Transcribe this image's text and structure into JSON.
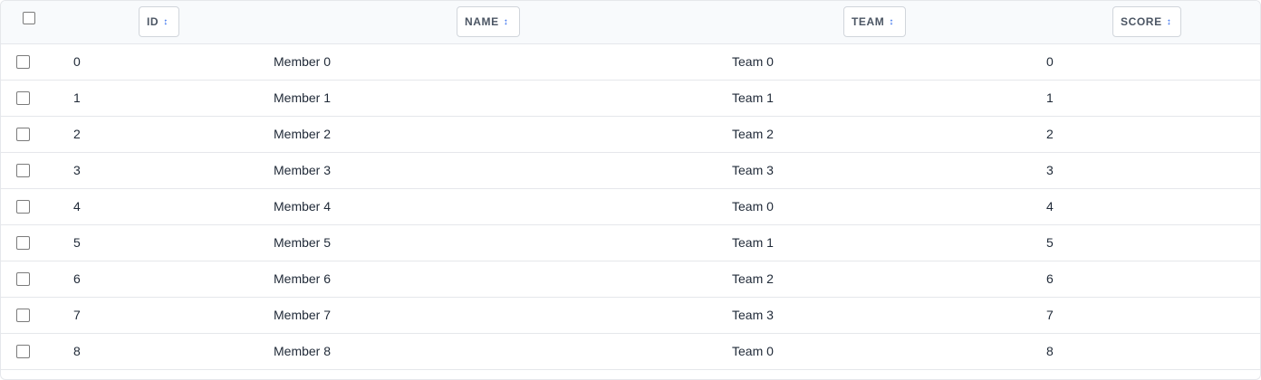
{
  "table": {
    "columns": [
      {
        "label": "ID",
        "sort_icon": "sort-updown-icon"
      },
      {
        "label": "NAME",
        "sort_icon": "sort-updown-icon"
      },
      {
        "label": "TEAM",
        "sort_icon": "sort-updown-icon"
      },
      {
        "label": "SCORE",
        "sort_icon": "sort-updown-icon"
      }
    ],
    "rows": [
      {
        "id": "0",
        "name": "Member 0",
        "team": "Team 0",
        "score": "0"
      },
      {
        "id": "1",
        "name": "Member 1",
        "team": "Team 1",
        "score": "1"
      },
      {
        "id": "2",
        "name": "Member 2",
        "team": "Team 2",
        "score": "2"
      },
      {
        "id": "3",
        "name": "Member 3",
        "team": "Team 3",
        "score": "3"
      },
      {
        "id": "4",
        "name": "Member 4",
        "team": "Team 0",
        "score": "4"
      },
      {
        "id": "5",
        "name": "Member 5",
        "team": "Team 1",
        "score": "5"
      },
      {
        "id": "6",
        "name": "Member 6",
        "team": "Team 2",
        "score": "6"
      },
      {
        "id": "7",
        "name": "Member 7",
        "team": "Team 3",
        "score": "7"
      },
      {
        "id": "8",
        "name": "Member 8",
        "team": "Team 0",
        "score": "8"
      }
    ]
  },
  "colors": {
    "header_bg": "#f8fafc",
    "border": "#e5e7eb",
    "sort_icon": "#2563eb",
    "header_text": "#4b5563",
    "cell_text": "#1f2937"
  }
}
